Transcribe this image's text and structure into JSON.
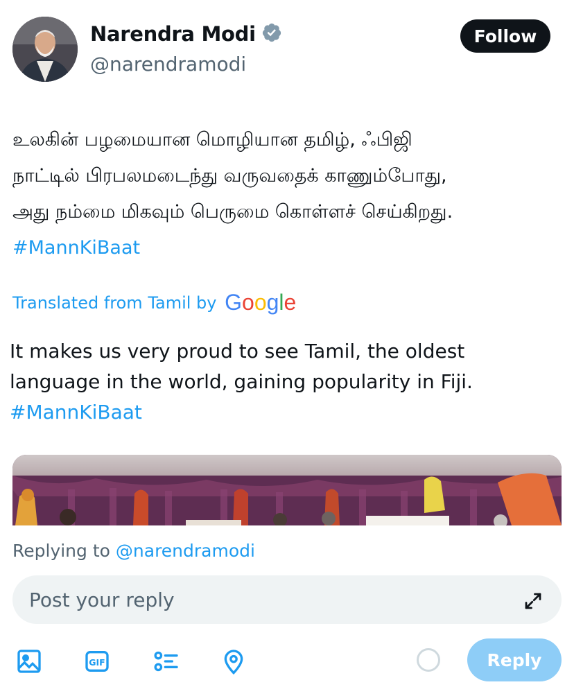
{
  "author": {
    "name": "Narendra Modi",
    "handle": "@narendramodi",
    "verified_icon": "verified-badge-icon",
    "follow_label": "Follow"
  },
  "tweet": {
    "tamil_lines": [
      "உலகின் பழமையான மொழியான தமிழ், ஃபிஜி",
      "நாட்டில் பிரபலமடைந்து வருவதைக் காணும்போது,",
      "அது நம்மை மிகவும் பெருமை கொள்ளச் செய்கிறது."
    ],
    "hashtag": "#MannKiBaat",
    "translated_from": "Translated from Tamil by",
    "google_logo": "Google",
    "translation_lines": [
      "It makes us very proud to see Tamil, the oldest",
      "language in the world, gaining popularity in Fiji."
    ]
  },
  "reply": {
    "replying_to_prefix": "Replying to",
    "replying_to_handle": "@narendramodi",
    "placeholder": "Post your reply",
    "reply_label": "Reply",
    "toolbar_icons": [
      "image-icon",
      "gif-icon",
      "poll-icon",
      "location-icon"
    ]
  },
  "colors": {
    "accent": "#1d9bf0",
    "text_secondary": "#536471",
    "reply_disabled": "#8ecdf7",
    "follow_bg": "#0f1419"
  }
}
